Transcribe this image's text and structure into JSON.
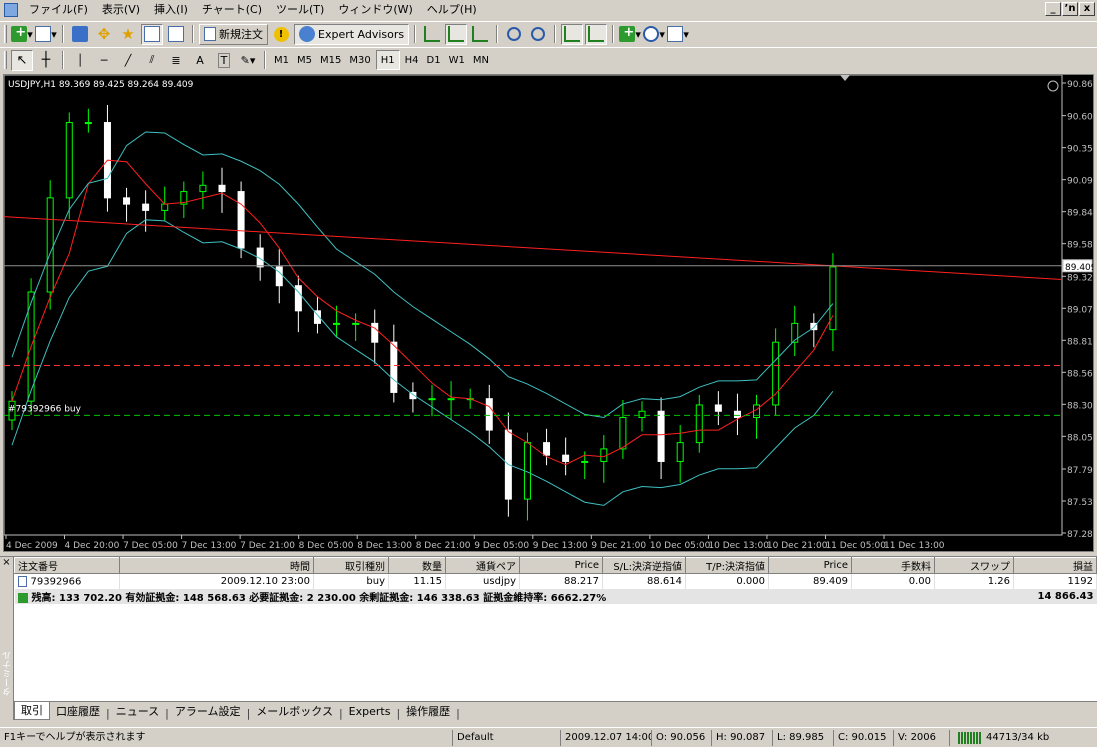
{
  "menu": {
    "items": [
      "ファイル(F)",
      "表示(V)",
      "挿入(I)",
      "チャート(C)",
      "ツール(T)",
      "ウィンドウ(W)",
      "ヘルプ(H)"
    ],
    "window_controls": [
      "_",
      "ʼn",
      "x"
    ]
  },
  "toolbar": {
    "new_order_label": "新規注文",
    "expert_advisors_label": "Expert Advisors",
    "timeframes": [
      "M1",
      "M5",
      "M15",
      "M30",
      "H1",
      "H4",
      "D1",
      "W1",
      "MN"
    ],
    "active_timeframe": "H1",
    "drawing_tools": [
      "cursor",
      "crosshair",
      "vertical-line",
      "horizontal-line",
      "trendline",
      "channel",
      "fibonacci",
      "text",
      "label",
      "arrows"
    ],
    "text_tool_label": "A",
    "label_tool_label": "T"
  },
  "chart": {
    "header": "USDJPY,H1  89.369 89.425 89.264 89.409",
    "order_label": "#79392966 buy",
    "current_price": "89.409",
    "price_ticks": [
      "90.865",
      "90.605",
      "90.350",
      "90.095",
      "89.840",
      "89.585",
      "89.325",
      "89.070",
      "88.815",
      "88.560",
      "88.305",
      "88.050",
      "87.790",
      "87.535",
      "87.280"
    ],
    "time_ticks": [
      "4 Dec 2009",
      "4 Dec 20:00",
      "7 Dec 05:00",
      "7 Dec 13:00",
      "7 Dec 21:00",
      "8 Dec 05:00",
      "8 Dec 13:00",
      "8 Dec 21:00",
      "9 Dec 05:00",
      "9 Dec 13:00",
      "9 Dec 21:00",
      "10 Dec 05:00",
      "10 Dec 13:00",
      "10 Dec 21:00",
      "11 Dec 05:00",
      "11 Dec 13:00"
    ],
    "colors": {
      "background": "#000000",
      "bull": "#00ff00",
      "bear": "#ffffff",
      "ma": "#ff2020",
      "bands": "#40c0c0",
      "tp_line": "#ff3030",
      "entry_line": "#00c000"
    }
  },
  "chart_data": {
    "type": "candlestick",
    "symbol": "USDJPY",
    "timeframe": "H1",
    "ohlc_last": {
      "open": 89.369,
      "high": 89.425,
      "low": 89.264,
      "close": 89.409
    },
    "ylim": [
      87.28,
      90.865
    ],
    "close_approx": [
      88.33,
      89.2,
      89.95,
      90.55,
      90.55,
      89.95,
      89.9,
      89.85,
      89.9,
      90.0,
      90.05,
      90.0,
      89.55,
      89.4,
      89.25,
      89.05,
      88.95,
      88.95,
      88.95,
      88.8,
      88.4,
      88.35,
      88.35,
      88.35,
      88.35,
      88.1,
      87.55,
      88.0,
      87.9,
      87.85,
      87.85,
      87.95,
      88.2,
      88.25,
      87.85,
      88.0,
      88.3,
      88.25,
      88.2,
      88.3,
      88.8,
      88.95,
      88.9,
      89.4
    ],
    "entry_price": 88.217,
    "take_profit": 88.614,
    "current": 89.409
  },
  "terminal": {
    "columns": [
      "注文番号",
      "時間",
      "取引種別",
      "数量",
      "通貨ペア",
      "Price",
      "S/L:決済逆指値",
      "T/P:決済指値",
      "Price",
      "手数料",
      "スワップ",
      "損益"
    ],
    "order": {
      "id": "79392966",
      "time": "2009.12.10 23:00",
      "type": "buy",
      "volume": "11.15",
      "symbol": "usdjpy",
      "price": "88.217",
      "sl": "88.614",
      "tp": "0.000",
      "current_price": "89.409",
      "commission": "0.00",
      "swap": "1.26",
      "profit": "1192"
    },
    "summary": "残高: 133 702.20  有効証拠金: 148 568.63  必要証拠金: 2 230.00  余剰証拠金: 146 338.63  証拠金維持率: 6662.27%",
    "summary_total": "14 866.43",
    "side_label": "ターミナル",
    "tabs": [
      "取引",
      "口座履歴",
      "ニュース",
      "アラーム設定",
      "メールボックス",
      "Experts",
      "操作履歴"
    ]
  },
  "status": {
    "help": "F1キーでヘルプが表示されます",
    "profile": "Default",
    "datetime": "2009.12.07 14:00",
    "open": "O: 90.056",
    "high": "H: 90.087",
    "low": "L: 89.985",
    "close": "C: 90.015",
    "volume": "V: 2006",
    "traffic": "44713/34 kb"
  }
}
